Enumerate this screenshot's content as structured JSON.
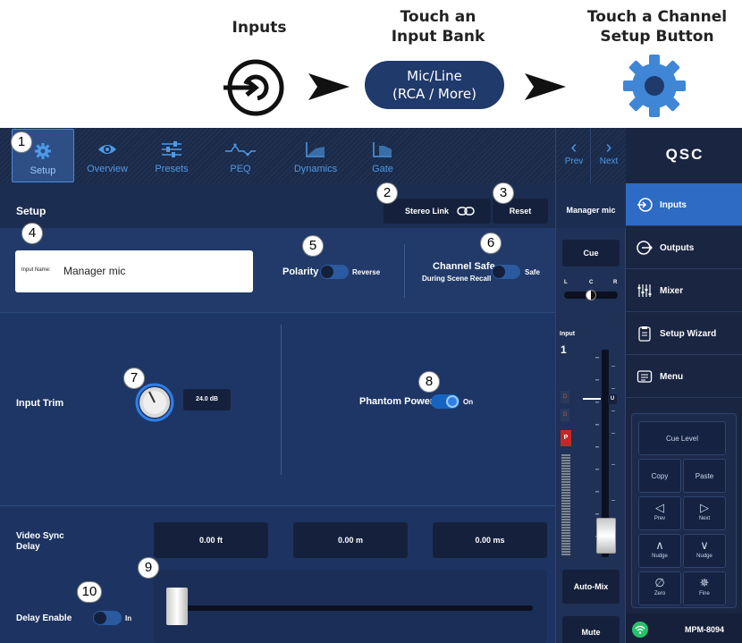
{
  "instructions": {
    "step1": "Inputs",
    "step2_line1": "Touch an",
    "step2_line2": "Input Bank",
    "step3_line1": "Touch a Channel",
    "step3_line2": "Setup Button",
    "bank_line1": "Mic/Line",
    "bank_line2": "(RCA / More)"
  },
  "tabs": [
    {
      "label": "Setup",
      "icon": "gear-icon"
    },
    {
      "label": "Overview",
      "icon": "eye-icon"
    },
    {
      "label": "Presets",
      "icon": "sliders-icon"
    },
    {
      "label": "PEQ",
      "icon": "peq-icon"
    },
    {
      "label": "Dynamics",
      "icon": "dynamics-icon"
    },
    {
      "label": "Gate",
      "icon": "gate-icon"
    }
  ],
  "nav": {
    "prev": "Prev",
    "next": "Next"
  },
  "brand": "QSC",
  "setup": {
    "title": "Setup",
    "stereo_link": "Stereo Link",
    "reset": "Reset",
    "input_name_label": "Input Name:",
    "input_name_value": "Manager mic",
    "polarity_label": "Polarity",
    "polarity_state": "Reverse",
    "channel_safe_label": "Channel Safe",
    "channel_safe_sub": "During Scene Recall",
    "channel_safe_state": "Safe",
    "input_trim_label": "Input Trim",
    "input_trim_value": "24.0 dB",
    "phantom_label": "Phantom Power",
    "phantom_state": "On",
    "video_sync_line1": "Video Sync",
    "video_sync_line2": "Delay",
    "delay_ft": "0.00 ft",
    "delay_m": "0.00 m",
    "delay_ms": "0.00 ms",
    "delay_enable_label": "Delay Enable",
    "delay_enable_state": "In"
  },
  "strip": {
    "channel_name": "Manager mic",
    "cue": "Cue",
    "pan_l": "L",
    "pan_c": "C",
    "pan_r": "R",
    "input_label": "Input",
    "channel_number": "1",
    "ind_d": "D",
    "ind_g": "G",
    "ind_p": "P",
    "unity_mark": "U",
    "automix": "Auto-Mix",
    "mute": "Mute"
  },
  "right_nav": [
    {
      "label": "Inputs",
      "icon": "inputs-icon",
      "active": true
    },
    {
      "label": "Outputs",
      "icon": "outputs-icon",
      "active": false
    },
    {
      "label": "Mixer",
      "icon": "mixer-icon",
      "active": false
    },
    {
      "label": "Setup Wizard",
      "icon": "wizard-icon",
      "active": false
    },
    {
      "label": "Menu",
      "icon": "menu-icon",
      "active": false
    }
  ],
  "keypad": {
    "cue_level": "Cue Level",
    "copy": "Copy",
    "paste": "Paste",
    "prev": "Prev",
    "next": "Next",
    "nudge_up": "Nudge",
    "nudge_down": "Nudge",
    "zero": "Zero",
    "fine": "Fine"
  },
  "device_model": "MPM-8094",
  "callouts": [
    "1",
    "2",
    "3",
    "4",
    "5",
    "6",
    "7",
    "8",
    "9",
    "10"
  ],
  "colors": {
    "accent": "#2d6bc5",
    "panel": "#1e3563",
    "tab_text": "#4d9be8",
    "gear_blue": "#3f86d6",
    "cue_red": "#c62828"
  }
}
